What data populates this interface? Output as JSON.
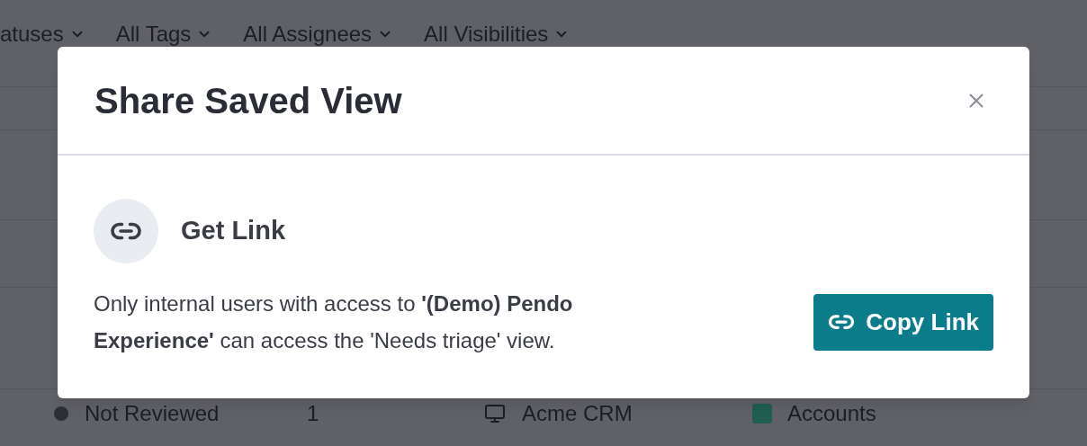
{
  "filters": [
    {
      "label": "atuses"
    },
    {
      "label": "All Tags"
    },
    {
      "label": "All Assignees"
    },
    {
      "label": "All Visibilities"
    }
  ],
  "rows": [
    {
      "status": "Not Reviewed",
      "color": "#2e2f34",
      "count": "1",
      "app": "Acme CRM",
      "tag": {
        "label": "Accounts",
        "color": "#1f5e50"
      }
    }
  ],
  "dialog": {
    "title": "Share Saved View",
    "section": {
      "title": "Get Link",
      "description": "Only internal users with access to **'(Demo) Pendo Experience'** can access the 'Needs triage' view.",
      "button": "Copy Link"
    }
  }
}
